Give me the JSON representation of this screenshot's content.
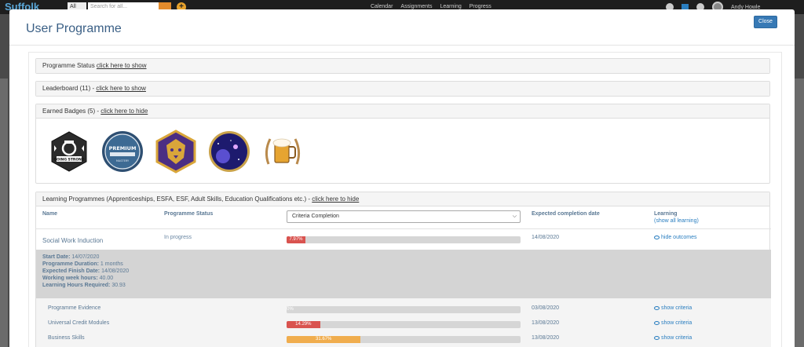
{
  "app": {
    "logo": "Suffolk",
    "search_scope": "All",
    "search_placeholder": "Search for all...",
    "nav": [
      "Calendar",
      "Assignments",
      "Learning",
      "Progress"
    ],
    "user_name": "Andy Howle"
  },
  "modal": {
    "title": "User Programme",
    "close_label": "Close"
  },
  "panels": {
    "programme_status": {
      "label": "Programme Status ",
      "link": "click here to show"
    },
    "leaderboard": {
      "label": "Leaderboard (11) - ",
      "link": "click here to show"
    },
    "earned_badges": {
      "label": "Earned Badges (5) - ",
      "link": "click here to hide"
    },
    "learning_programmes": {
      "label": "Learning Programmes (Apprenticeships, ESFA, ESF, Adult Skills, Education Qualifications etc.) - ",
      "link": "click here to hide"
    }
  },
  "badges": [
    {
      "icon": "going-strong-badge-icon",
      "text": "GOING STRONG"
    },
    {
      "icon": "premium-mastery-badge-icon",
      "text": "PREMIUM",
      "subtext": "MASTERY"
    },
    {
      "icon": "lion-badge-icon"
    },
    {
      "icon": "space-badge-icon"
    },
    {
      "icon": "beer-mug-badge-icon"
    }
  ],
  "table": {
    "headers": {
      "name": "Name",
      "status": "Programme Status",
      "completion_select": "Criteria Completion",
      "expected": "Expected completion date",
      "learning": "Learning",
      "learning_link": "(show all learning)"
    },
    "programme": {
      "name": "Social Work Induction",
      "status": "In progress",
      "progress_label": "7.97%",
      "progress": 7.97,
      "expected": "14/08/2020",
      "action": "hide outcomes",
      "details": [
        {
          "label": "Start Date",
          "value": "14/07/2020"
        },
        {
          "label": "Programme Duration",
          "value": "1 months"
        },
        {
          "label": "Expected Finish Date",
          "value": "14/08/2020"
        },
        {
          "label": "Working week hours",
          "value": "40.00"
        },
        {
          "label": "Learning Hours Required",
          "value": "30.93"
        }
      ]
    },
    "outcomes": [
      {
        "name": "Programme Evidence",
        "progress_label": "0%",
        "progress": 0,
        "expected": "03/08/2020",
        "action": "show criteria",
        "color": "#d6d6d6"
      },
      {
        "name": "Universal Credit Modules",
        "progress_label": "14.29%",
        "progress": 14.29,
        "expected": "13/08/2020",
        "action": "show criteria",
        "color": "#d9534f"
      },
      {
        "name": "Business Skills",
        "progress_label": "31.67%",
        "progress": 31.67,
        "expected": "13/08/2020",
        "action": "show criteria",
        "color": "#f0ad4e"
      }
    ],
    "colors": {
      "programme_bar": "#d9534f"
    }
  }
}
